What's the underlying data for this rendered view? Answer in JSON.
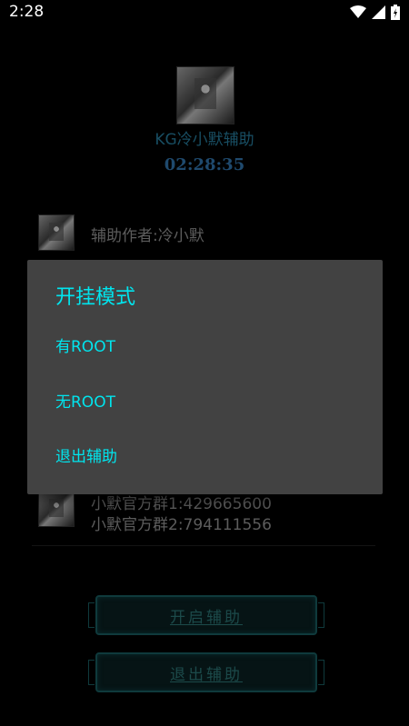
{
  "status_bar": {
    "time": "2:28"
  },
  "app": {
    "title": "KG冷小默辅助",
    "clock": "02:28:35",
    "author_label": "辅助作者:冷小默",
    "group_1": "小默官方群1:429665600",
    "group_2": "小默官方群2:794111556",
    "start_button": "开启辅助",
    "exit_button": "退出辅助"
  },
  "dialog": {
    "title": "开挂模式",
    "options": [
      "有ROOT",
      "无ROOT",
      "退出辅助"
    ]
  }
}
